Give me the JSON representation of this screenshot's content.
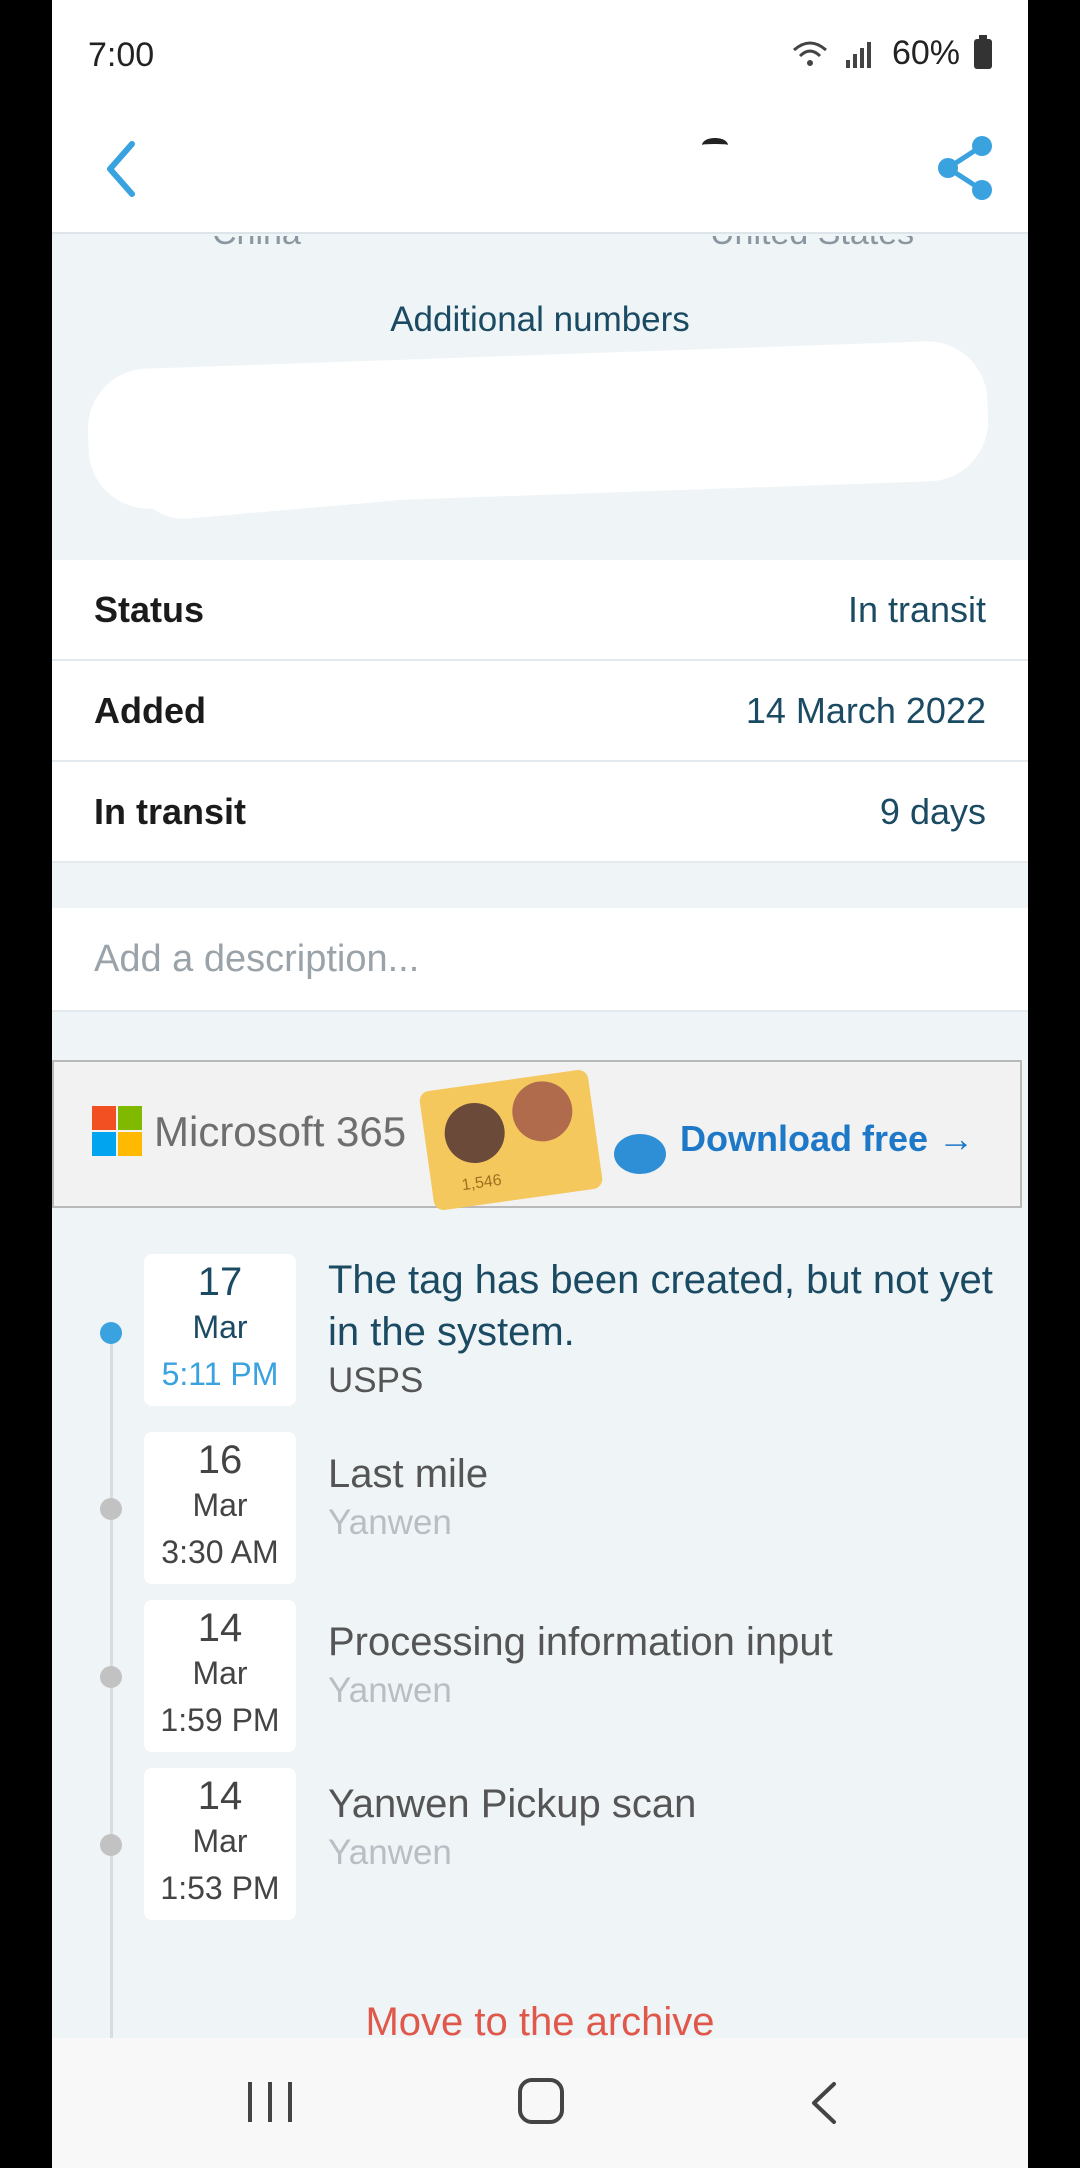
{
  "status_bar": {
    "time": "7:00",
    "battery": "60%"
  },
  "app_bar": {
    "back_icon": "chevron-left-icon",
    "share_icon": "share-icon"
  },
  "route": {
    "from": "China",
    "to": "United States"
  },
  "additional_numbers_label": "Additional numbers",
  "info_rows": [
    {
      "label": "Status",
      "value": "In transit"
    },
    {
      "label": "Added",
      "value": "14 March 2022"
    },
    {
      "label": "In transit",
      "value": "9 days"
    }
  ],
  "description_placeholder": "Add a description...",
  "ad": {
    "brand": "Microsoft 365",
    "folder_number": "1,546",
    "cta": "Download free →"
  },
  "events": [
    {
      "day": "17",
      "month": "Mar",
      "time": "5:11 PM",
      "title": "The tag has been created, but not yet in the system.",
      "carrier": "USPS"
    },
    {
      "day": "16",
      "month": "Mar",
      "time": "3:30 AM",
      "title": "Last mile",
      "carrier": "Yanwen"
    },
    {
      "day": "14",
      "month": "Mar",
      "time": "1:59 PM",
      "title": "Processing information input",
      "carrier": "Yanwen"
    },
    {
      "day": "14",
      "month": "Mar",
      "time": "1:53 PM",
      "title": "Yanwen Pickup scan",
      "carrier": "Yanwen"
    }
  ],
  "archive_action": "Move to the archive",
  "colors": {
    "accent": "#3aa2df",
    "text_dark": "#1b4a63",
    "danger": "#e0584a",
    "background": "#eff4f7"
  }
}
